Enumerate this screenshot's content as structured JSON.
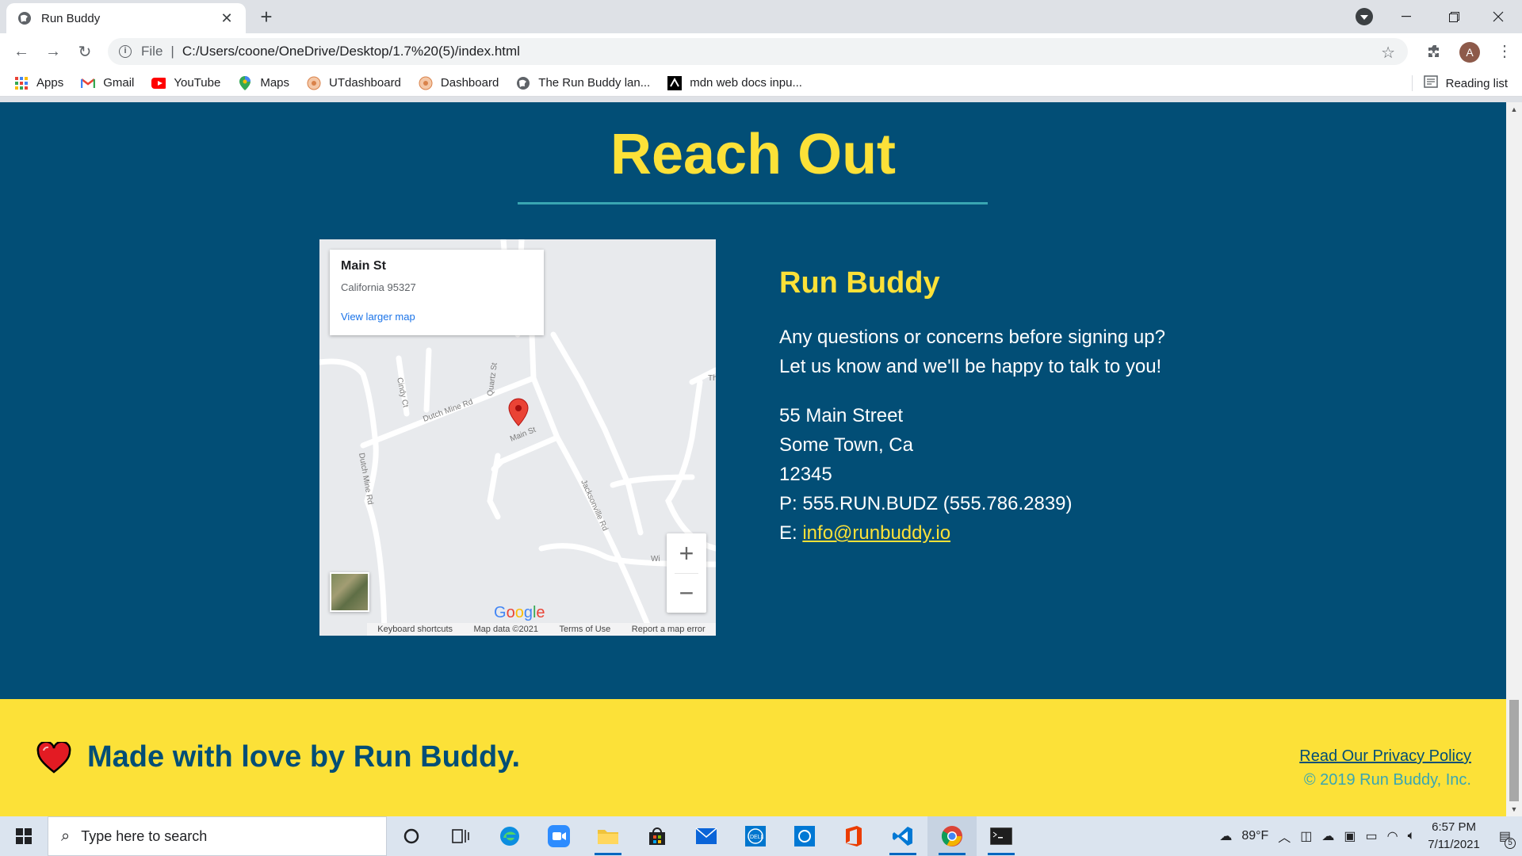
{
  "browser": {
    "tab_title": "Run Buddy",
    "url_scheme": "File",
    "url": "C:/Users/coone/OneDrive/Desktop/1.7%20(5)/index.html",
    "profile_initial": "A",
    "bookmarks": [
      {
        "label": "Apps",
        "icon": "apps-grid-icon"
      },
      {
        "label": "Gmail",
        "icon": "gmail-icon"
      },
      {
        "label": "YouTube",
        "icon": "youtube-icon"
      },
      {
        "label": "Maps",
        "icon": "maps-icon"
      },
      {
        "label": "UTdashboard",
        "icon": "utdashboard-icon"
      },
      {
        "label": "Dashboard",
        "icon": "dashboard-icon"
      },
      {
        "label": "The Run Buddy lan...",
        "icon": "globe-icon"
      },
      {
        "label": "mdn web docs inpu...",
        "icon": "mdn-icon"
      }
    ],
    "reading_list": "Reading list"
  },
  "page": {
    "section_title": "Reach Out",
    "map": {
      "card_title": "Main St",
      "card_address": "California 95327",
      "card_link": "View larger map",
      "streets": [
        "Cindy Ct",
        "Dutch Mine Rd",
        "Quartz St",
        "Main St",
        "Dutch Mine Rd",
        "Jacksonville Rd",
        "Wi",
        "Th"
      ],
      "zoom_in": "+",
      "zoom_out": "−",
      "footer": {
        "shortcuts": "Keyboard shortcuts",
        "data": "Map data ©2021",
        "terms": "Terms of Use",
        "report": "Report a map error"
      }
    },
    "contact": {
      "heading": "Run Buddy",
      "line1": "Any questions or concerns before signing up?",
      "line2": "Let us know and we'll be happy to talk to you!",
      "street": "55 Main Street",
      "city": "Some Town, Ca",
      "zip": "12345",
      "phone": "P: 555.RUN.BUDZ (555.786.2839)",
      "email_prefix": "E: ",
      "email": "info@runbuddy.io"
    },
    "footer": {
      "made_with": "Made with love by Run Buddy.",
      "privacy": "Read Our Privacy Policy",
      "copyright": "© 2019 Run Buddy, Inc."
    }
  },
  "taskbar": {
    "search_placeholder": "Type here to search",
    "weather": "89°F",
    "time": "6:57 PM",
    "date": "7/11/2021",
    "notifications": "5"
  },
  "colors": {
    "primary": "#024e76",
    "accent": "#fce138",
    "teal": "#39a6b2"
  }
}
